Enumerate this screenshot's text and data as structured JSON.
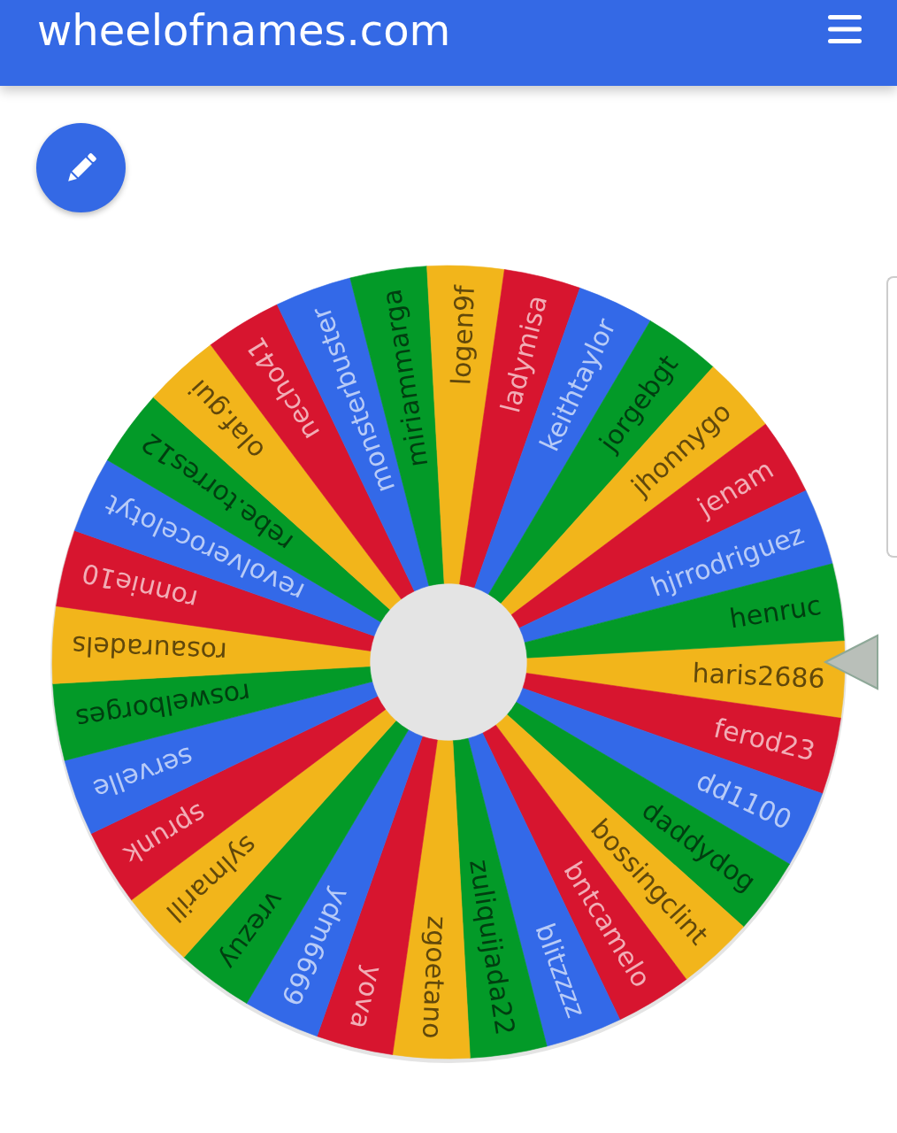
{
  "header": {
    "title": "wheelofnames.com"
  },
  "wheel": {
    "slices": [
      {
        "name": "haris2686",
        "color": "#f2b51b"
      },
      {
        "name": "ferod23",
        "color": "#d7152f"
      },
      {
        "name": "dd1100",
        "color": "#3369e8"
      },
      {
        "name": "daddydog",
        "color": "#039a28"
      },
      {
        "name": "bossingclint",
        "color": "#f2b51b"
      },
      {
        "name": "bntcamelo",
        "color": "#d7152f"
      },
      {
        "name": "blitzzzz",
        "color": "#3369e8"
      },
      {
        "name": "zuliquijada22",
        "color": "#039a28"
      },
      {
        "name": "zgoetano",
        "color": "#f2b51b"
      },
      {
        "name": "yova",
        "color": "#d7152f"
      },
      {
        "name": "ydm6669",
        "color": "#3369e8"
      },
      {
        "name": "vrezuy",
        "color": "#039a28"
      },
      {
        "name": "sylmarill",
        "color": "#f2b51b"
      },
      {
        "name": "sprunk",
        "color": "#d7152f"
      },
      {
        "name": "servelle",
        "color": "#3369e8"
      },
      {
        "name": "roswelborges",
        "color": "#039a28"
      },
      {
        "name": "rosauradels",
        "color": "#f2b51b"
      },
      {
        "name": "ronnie10",
        "color": "#d7152f"
      },
      {
        "name": "revolverocelotyt",
        "color": "#3369e8"
      },
      {
        "name": "rebe.torres12",
        "color": "#039a28"
      },
      {
        "name": "olaf.gui",
        "color": "#f2b51b"
      },
      {
        "name": "necho41",
        "color": "#d7152f"
      },
      {
        "name": "monsterbuster",
        "color": "#3369e8"
      },
      {
        "name": "miriammarga",
        "color": "#039a28"
      },
      {
        "name": "logen9f",
        "color": "#f2b51b"
      },
      {
        "name": "ladymisa",
        "color": "#d7152f"
      },
      {
        "name": "keithtaylor",
        "color": "#3369e8"
      },
      {
        "name": "jorgebgt",
        "color": "#039a28"
      },
      {
        "name": "jhonnygo",
        "color": "#f2b51b"
      },
      {
        "name": "jenam",
        "color": "#d7152f"
      },
      {
        "name": "hjrrodriguez",
        "color": "#3369e8"
      },
      {
        "name": "henruc",
        "color": "#039a28"
      }
    ]
  }
}
